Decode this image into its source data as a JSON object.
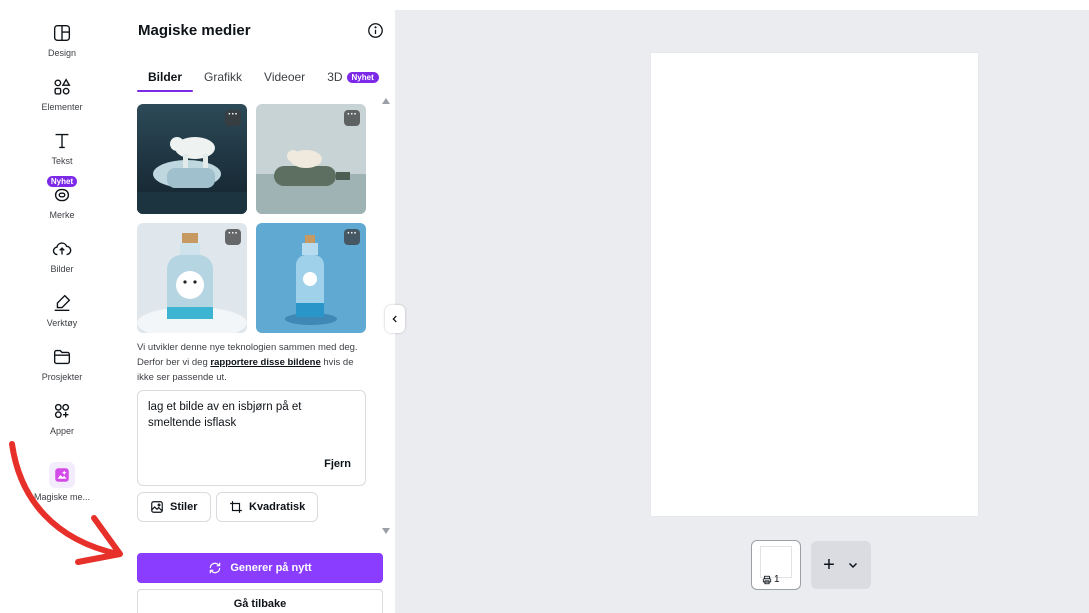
{
  "rail": {
    "items": [
      {
        "label": "Design"
      },
      {
        "label": "Elementer"
      },
      {
        "label": "Tekst"
      },
      {
        "label": "Merke",
        "badge": "Nyhet"
      },
      {
        "label": "Bilder"
      },
      {
        "label": "Verktøy"
      },
      {
        "label": "Prosjekter"
      },
      {
        "label": "Apper"
      },
      {
        "label": "Magiske me..."
      }
    ]
  },
  "panel": {
    "title": "Magiske medier",
    "tabs": [
      {
        "label": "Bilder"
      },
      {
        "label": "Grafikk"
      },
      {
        "label": "Videoer"
      },
      {
        "label": "3D",
        "badge": "Nyhet"
      }
    ],
    "disclaimer": {
      "before": "Vi utvikler denne nye teknologien sammen med deg. Derfor ber vi deg ",
      "link": "rapportere disse bildene",
      "after": " hvis de ikke ser passende ut."
    },
    "prompt": "lag et bilde av en isbjørn på et smeltende isflask",
    "remove_label": "Fjern",
    "style_label": "Stiler",
    "ratio_label": "Kvadratisk",
    "regenerate_label": "Generer på nytt",
    "back_label": "Gå tilbake",
    "more_label": "···"
  },
  "canvas": {
    "page_number": "1",
    "add_label": "+"
  },
  "colors": {
    "accent": "#8b3dff",
    "badge": "#7d2ae8",
    "workspace": "#ebecf0",
    "arrow": "#e8302a"
  }
}
